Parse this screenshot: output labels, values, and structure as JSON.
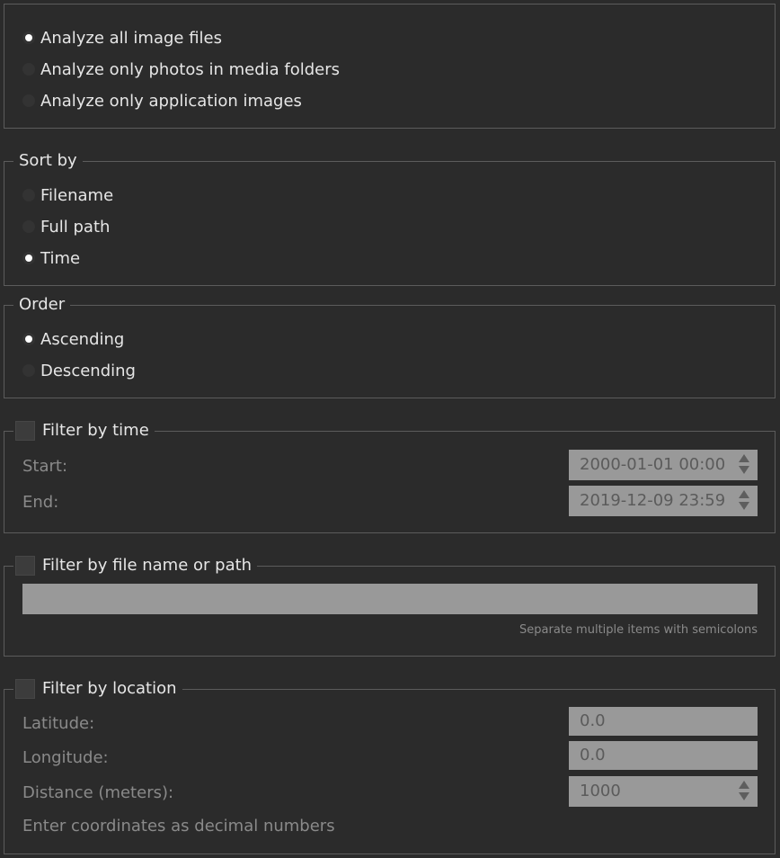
{
  "scope": {
    "options": [
      {
        "label": "Analyze all image files",
        "checked": true
      },
      {
        "label": "Analyze only photos in media folders",
        "checked": false
      },
      {
        "label": "Analyze only application images",
        "checked": false
      }
    ]
  },
  "sort": {
    "title": "Sort by",
    "options": [
      {
        "label": "Filename",
        "checked": false
      },
      {
        "label": "Full path",
        "checked": false
      },
      {
        "label": "Time",
        "checked": true
      }
    ]
  },
  "order": {
    "title": "Order",
    "options": [
      {
        "label": "Ascending",
        "checked": true
      },
      {
        "label": "Descending",
        "checked": false
      }
    ]
  },
  "filter_time": {
    "title": "Filter by time",
    "checked": false,
    "start_label": "Start:",
    "start_value": "2000-01-01 00:00",
    "end_label": "End:",
    "end_value": "2019-12-09 23:59"
  },
  "filter_name": {
    "title": "Filter by file name or path",
    "checked": false,
    "value": "",
    "hint": "Separate multiple items with semicolons"
  },
  "filter_location": {
    "title": "Filter by location",
    "checked": false,
    "latitude_label": "Latitude:",
    "latitude_value": "0.0",
    "longitude_label": "Longitude:",
    "longitude_value": "0.0",
    "distance_label": "Distance (meters):",
    "distance_value": "1000",
    "hint": "Enter coordinates as decimal numbers"
  }
}
